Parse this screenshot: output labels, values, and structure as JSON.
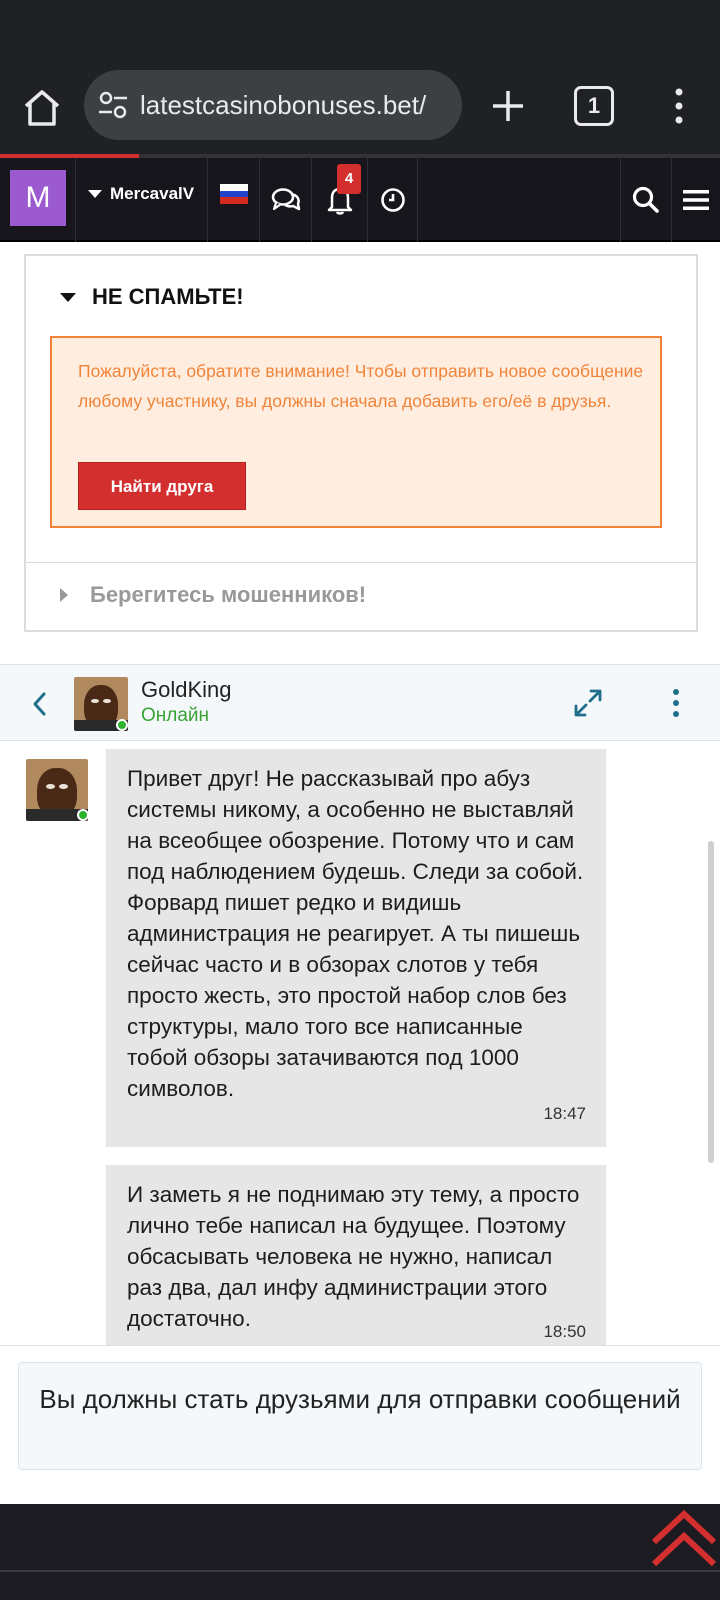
{
  "browser": {
    "url": "latestcasinobonuses.bet/",
    "tab_count": "1"
  },
  "forum_nav": {
    "avatar_letter": "M",
    "username": "MercavalV",
    "notification_count": "4"
  },
  "notice": {
    "title": "НЕ СПАМЬТЕ!",
    "warning_text": "Пожалуйста, обратите внимание! Чтобы отправить новое сообщение любому участнику, вы должны сначала добавить его/её в друзья.",
    "find_friend_label": "Найти друга",
    "scam_title": "Берегитесь мошенников!"
  },
  "chat": {
    "contact_name": "GoldKing",
    "contact_status": "Онлайн",
    "messages": [
      {
        "text": "Привет друг! Не рассказывай про абуз системы никому, а особенно не выставляй на всеобщее обозрение. Потому что и сам под наблюдением будешь. Следи за собой. Форвард пишет редко и видишь администрация не реагирует. А ты пишешь сейчас часто и в обзорах слотов у тебя просто жесть, это простой набор слов без структуры, мало того все написанные тобой обзоры затачиваются под 1000 символов.",
        "time": "18:47"
      },
      {
        "text": "И заметь я не поднимаю эту тему, а просто лично тебе написал на будущее. Поэтому обсасывать человека не нужно, написал раз два, дал инфу администрации этого достаточно.",
        "time": "18:50"
      }
    ],
    "friends_required_text": "Вы должны стать друзьями для отправки сообщений"
  },
  "colors": {
    "accent_red": "#d32f2f",
    "warning_orange": "#f0843a",
    "online_green": "#3aa335",
    "avatar_purple": "#9c5ad1",
    "link_teal": "#1f6f8b"
  }
}
